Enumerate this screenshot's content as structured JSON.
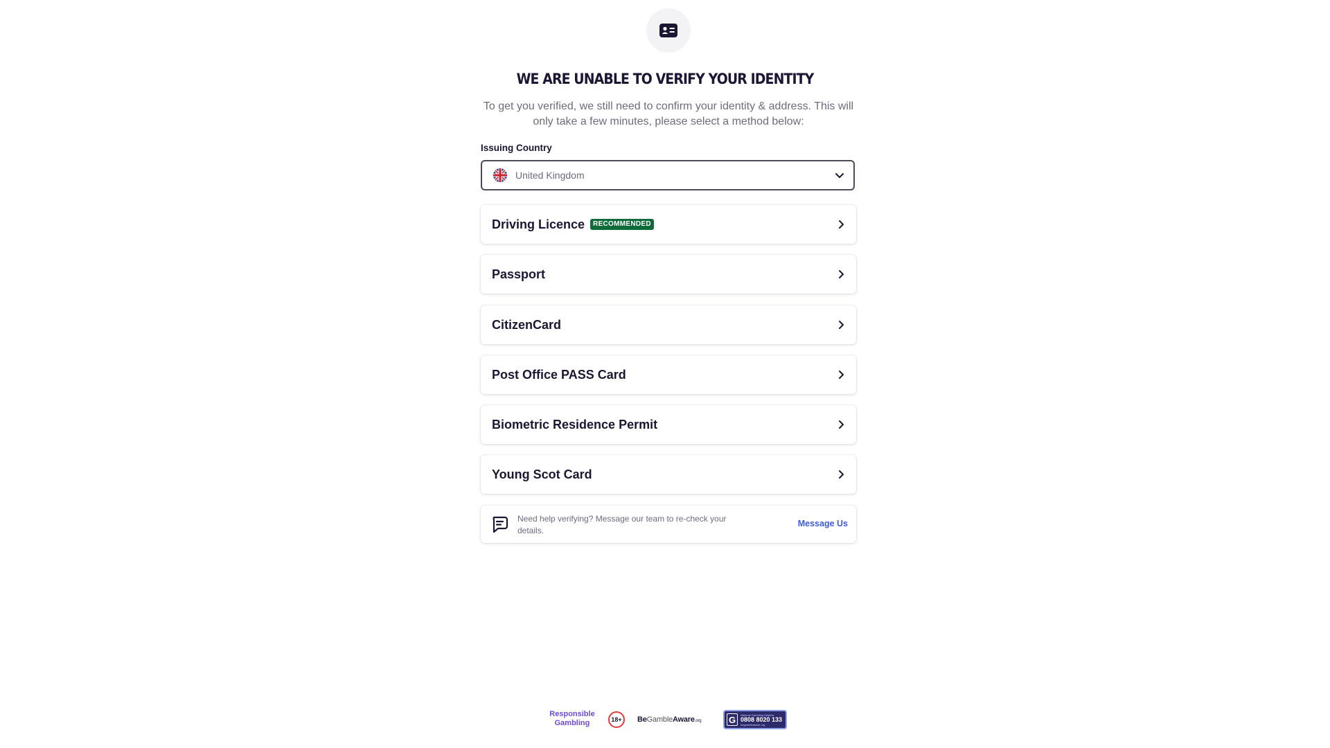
{
  "header": {
    "icon": "id-card-icon",
    "title": "WE ARE UNABLE TO VERIFY YOUR IDENTITY",
    "subtitle": "To get you verified, we still need to confirm your identity & address. This will only take a few minutes, please select a method below:"
  },
  "country_select": {
    "label": "Issuing Country",
    "value": "United Kingdom",
    "flag": "uk-flag-icon"
  },
  "methods": [
    {
      "label": "Driving Licence",
      "badge": "RECOMMENDED"
    },
    {
      "label": "Passport"
    },
    {
      "label": "CitizenCard"
    },
    {
      "label": "Post Office PASS Card"
    },
    {
      "label": "Biometric Residence Permit"
    },
    {
      "label": "Young Scot Card"
    }
  ],
  "help": {
    "icon": "chat-bubble-icon",
    "text": "Need help verifying? Message our team to re-check your details.",
    "link": "Message Us"
  },
  "footer": {
    "responsible_gambling": "Responsible Gambling",
    "age_badge": "18+",
    "be_gamble_aware": {
      "be": "Be",
      "gamble": "Gamble",
      "aware": "Aware",
      "org": ".org"
    },
    "gambling_helpline": {
      "caption": "National Gambling Helpline",
      "number": "0808 8020 133",
      "sub": "begambleaware.org"
    }
  },
  "colors": {
    "text_dark": "#1c1533",
    "text_muted": "#6f6a7e",
    "badge_green": "#0f6b3a",
    "link_blue": "#3d5bd9"
  }
}
